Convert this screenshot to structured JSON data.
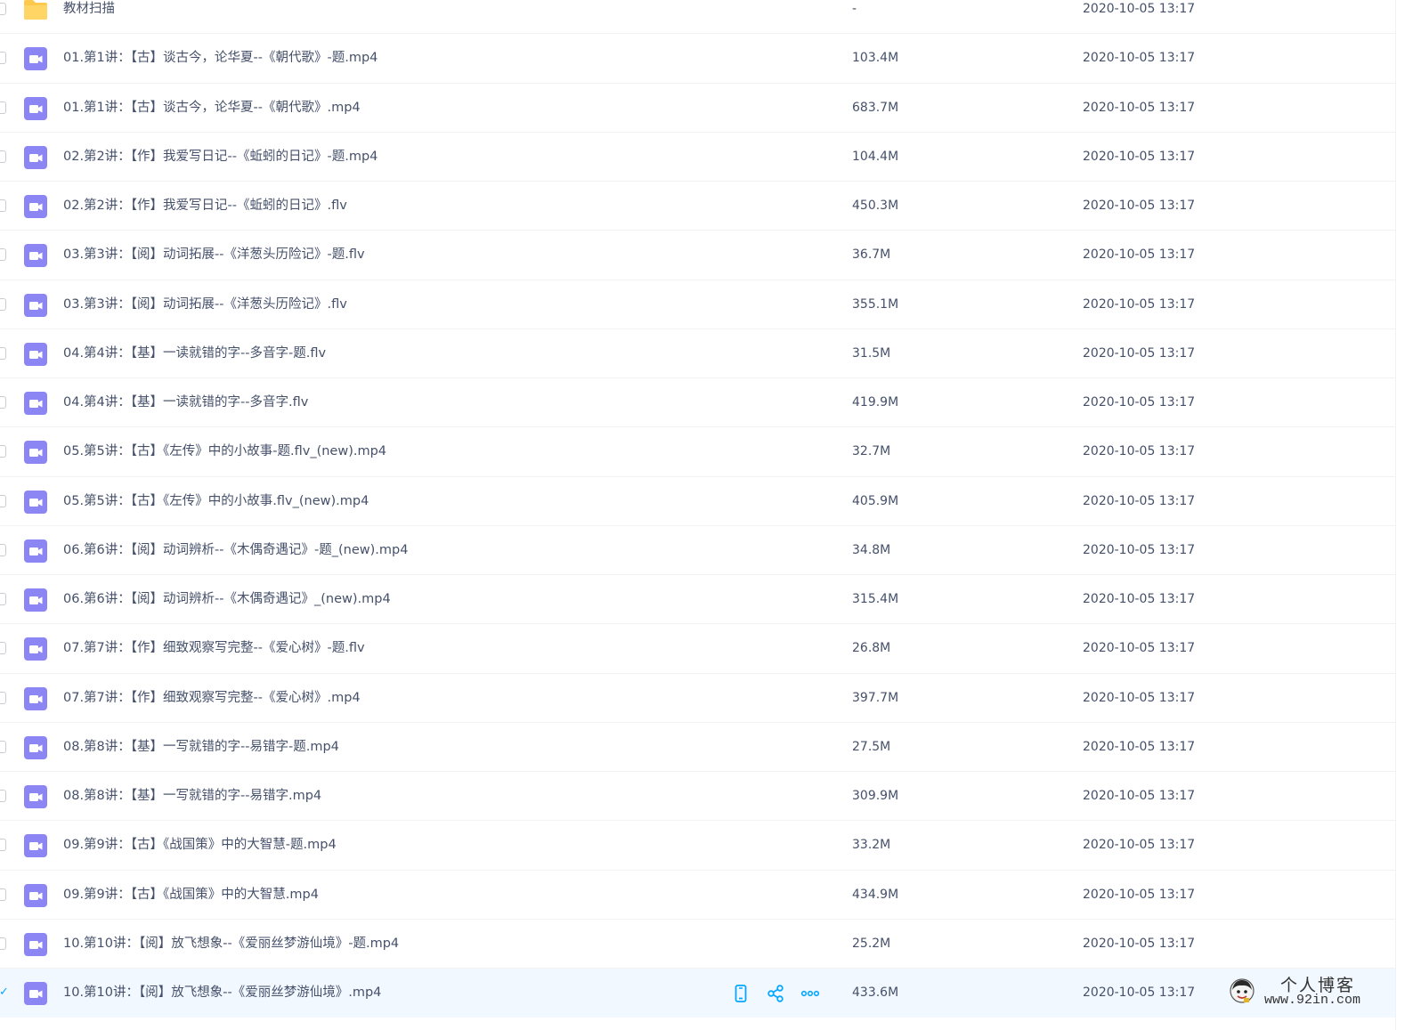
{
  "colors": {
    "folder": "#ffc94d",
    "video_icon": "#8b86f4",
    "accent": "#06a7ff",
    "selected_row": "#f2f8ff",
    "text": "#45506a"
  },
  "files": [
    {
      "type": "folder",
      "icon": "folder-icon",
      "name": "教材扫描",
      "size": "-",
      "date": "2020-10-05 13:17"
    },
    {
      "type": "video",
      "icon": "video-icon",
      "name": "01.第1讲：【古】谈古今，论华夏--《朝代歌》-题.mp4",
      "size": "103.4M",
      "date": "2020-10-05 13:17"
    },
    {
      "type": "video",
      "icon": "video-icon",
      "name": "01.第1讲：【古】谈古今，论华夏--《朝代歌》.mp4",
      "size": "683.7M",
      "date": "2020-10-05 13:17"
    },
    {
      "type": "video",
      "icon": "video-icon",
      "name": "02.第2讲：【作】我爱写日记--《蚯蚓的日记》-题.mp4",
      "size": "104.4M",
      "date": "2020-10-05 13:17"
    },
    {
      "type": "video",
      "icon": "video-icon",
      "name": "02.第2讲：【作】我爱写日记--《蚯蚓的日记》.flv",
      "size": "450.3M",
      "date": "2020-10-05 13:17"
    },
    {
      "type": "video",
      "icon": "video-icon",
      "name": "03.第3讲：【阅】动词拓展--《洋葱头历险记》-题.flv",
      "size": "36.7M",
      "date": "2020-10-05 13:17"
    },
    {
      "type": "video",
      "icon": "video-icon",
      "name": "03.第3讲：【阅】动词拓展--《洋葱头历险记》.flv",
      "size": "355.1M",
      "date": "2020-10-05 13:17"
    },
    {
      "type": "video",
      "icon": "video-icon",
      "name": "04.第4讲：【基】一读就错的字--多音字-题.flv",
      "size": "31.5M",
      "date": "2020-10-05 13:17"
    },
    {
      "type": "video",
      "icon": "video-icon",
      "name": "04.第4讲：【基】一读就错的字--多音字.flv",
      "size": "419.9M",
      "date": "2020-10-05 13:17"
    },
    {
      "type": "video",
      "icon": "video-icon",
      "name": "05.第5讲：【古】《左传》中的小故事-题.flv_(new).mp4",
      "size": "32.7M",
      "date": "2020-10-05 13:17"
    },
    {
      "type": "video",
      "icon": "video-icon",
      "name": "05.第5讲：【古】《左传》中的小故事.flv_(new).mp4",
      "size": "405.9M",
      "date": "2020-10-05 13:17"
    },
    {
      "type": "video",
      "icon": "video-icon",
      "name": "06.第6讲：【阅】动词辨析--《木偶奇遇记》-题_(new).mp4",
      "size": "34.8M",
      "date": "2020-10-05 13:17"
    },
    {
      "type": "video",
      "icon": "video-icon",
      "name": "06.第6讲：【阅】动词辨析--《木偶奇遇记》_(new).mp4",
      "size": "315.4M",
      "date": "2020-10-05 13:17"
    },
    {
      "type": "video",
      "icon": "video-icon",
      "name": "07.第7讲：【作】细致观察写完整--《爱心树》-题.flv",
      "size": "26.8M",
      "date": "2020-10-05 13:17"
    },
    {
      "type": "video",
      "icon": "video-icon",
      "name": "07.第7讲：【作】细致观察写完整--《爱心树》.mp4",
      "size": "397.7M",
      "date": "2020-10-05 13:17"
    },
    {
      "type": "video",
      "icon": "video-icon",
      "name": "08.第8讲：【基】一写就错的字--易错字-题.mp4",
      "size": "27.5M",
      "date": "2020-10-05 13:17"
    },
    {
      "type": "video",
      "icon": "video-icon",
      "name": "08.第8讲：【基】一写就错的字--易错字.mp4",
      "size": "309.9M",
      "date": "2020-10-05 13:17"
    },
    {
      "type": "video",
      "icon": "video-icon",
      "name": "09.第9讲：【古】《战国策》中的大智慧-题.mp4",
      "size": "33.2M",
      "date": "2020-10-05 13:17"
    },
    {
      "type": "video",
      "icon": "video-icon",
      "name": "09.第9讲：【古】《战国策》中的大智慧.mp4",
      "size": "434.9M",
      "date": "2020-10-05 13:17"
    },
    {
      "type": "video",
      "icon": "video-icon",
      "name": "10.第10讲：【阅】放飞想象--《爱丽丝梦游仙境》-题.mp4",
      "size": "25.2M",
      "date": "2020-10-05 13:17"
    },
    {
      "type": "video",
      "icon": "video-icon",
      "name": "10.第10讲：【阅】放飞想象--《爱丽丝梦游仙境》.mp4",
      "size": "433.6M",
      "date": "2020-10-05 13:17",
      "selected": true
    }
  ],
  "row_actions": [
    {
      "name": "phone-icon"
    },
    {
      "name": "share-icon"
    },
    {
      "name": "more-icon"
    }
  ],
  "watermark": {
    "title": "个人博客",
    "url": "www.92in.com"
  }
}
